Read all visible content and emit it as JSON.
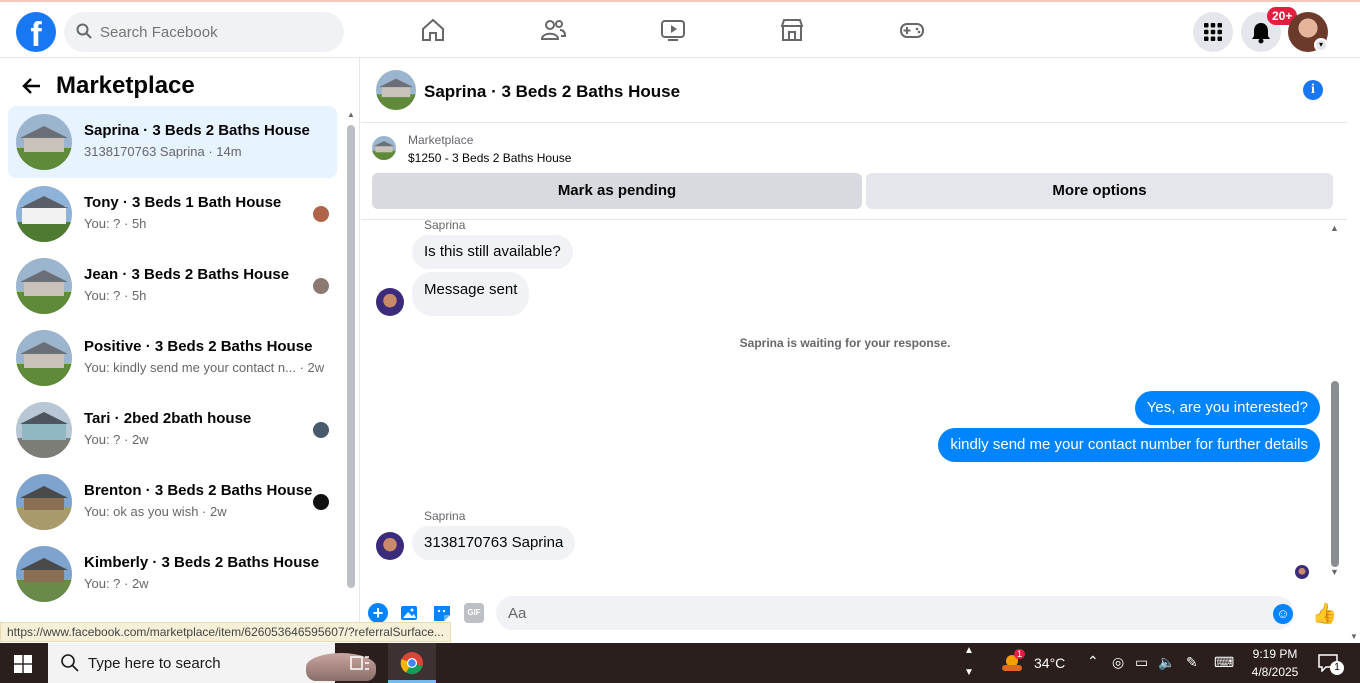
{
  "topbar": {
    "search_placeholder": "Search Facebook",
    "notification_badge": "20+",
    "brand_color": "#1877f2"
  },
  "sidebar": {
    "title": "Marketplace",
    "conversations": [
      {
        "title": "Saprina · 3 Beds 2 Baths House",
        "subtitle": "3138170763 Saprina · 14m",
        "active": true
      },
      {
        "title": "Tony · 3 Beds 1 Bath House",
        "subtitle": "You: ? · 5h"
      },
      {
        "title": "Jean · 3 Beds 2 Baths House",
        "subtitle": "You: ? · 5h"
      },
      {
        "title": "Positive · 3 Beds 2 Baths House",
        "subtitle": "You: kindly send me your contact n... · 2w"
      },
      {
        "title": "Tari · 2bed 2bath house",
        "subtitle": "You: ? · 2w"
      },
      {
        "title": "Brenton · 3 Beds 2 Baths House",
        "subtitle": "You: ok as you wish · 2w"
      },
      {
        "title": "Kimberly · 3 Beds 2 Baths House",
        "subtitle": "You: ? · 2w"
      }
    ]
  },
  "chat": {
    "header_title": "Saprina · 3 Beds 2 Baths House",
    "listing_source": "Marketplace",
    "listing_price_title": "$1250 - 3 Beds 2 Baths House",
    "mark_pending_label": "Mark as pending",
    "more_options_label": "More options",
    "messages": {
      "sender_1": "Saprina",
      "in_1": "Is this still available?",
      "in_2": "Message sent",
      "waiting": "Saprina is waiting for your response.",
      "out_1": "Yes, are you interested?",
      "out_2": "kindly send me your contact number for further details",
      "sender_2": "Saprina",
      "in_3": "3138170763 Saprina"
    },
    "composer_placeholder": "Aa",
    "outgoing_color": "#0084ff"
  },
  "status_url": "https://www.facebook.com/marketplace/item/626053646595607/?referralSurface...",
  "taskbar": {
    "search_placeholder": "Type here to search",
    "temperature": "34°C",
    "weather_badge": "1",
    "time": "9:19 PM",
    "date": "4/8/2025",
    "notification_count": "1"
  }
}
